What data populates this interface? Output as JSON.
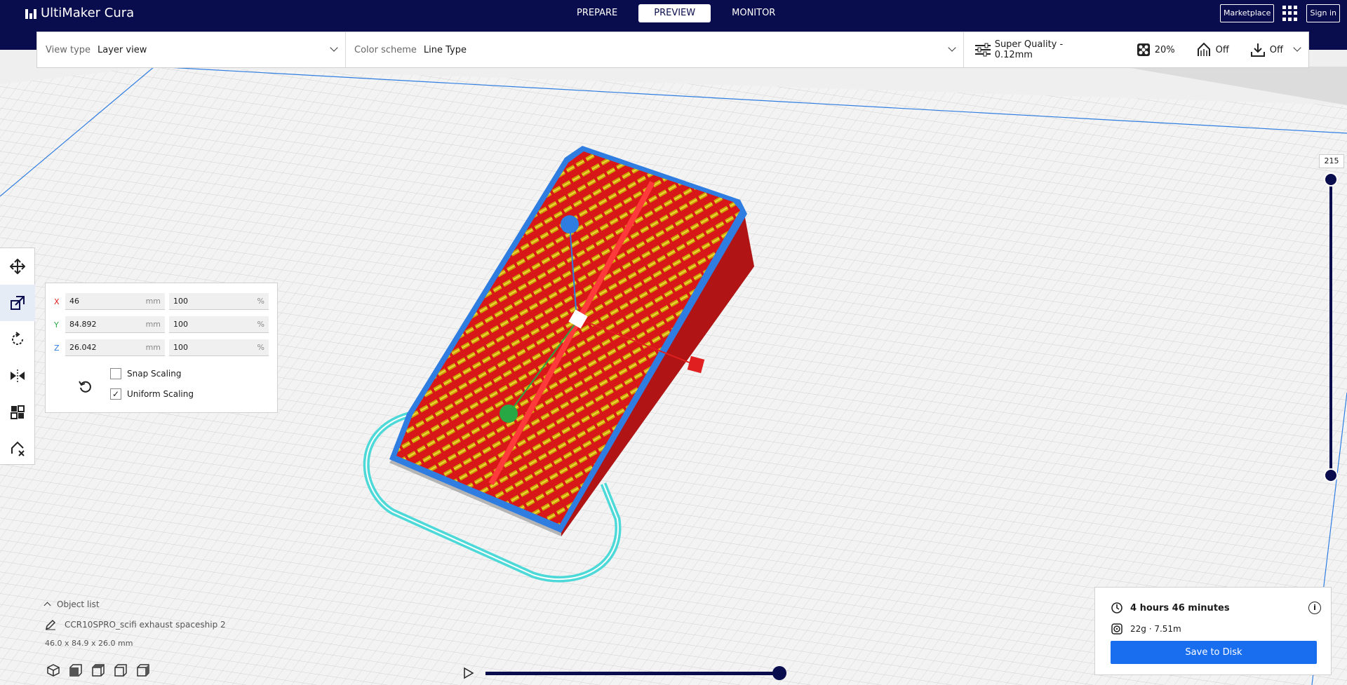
{
  "app": {
    "title": "UltiMaker Cura"
  },
  "nav": {
    "tabs": [
      "PREPARE",
      "PREVIEW",
      "MONITOR"
    ],
    "active": "PREVIEW"
  },
  "header_right": {
    "marketplace": "Marketplace",
    "signin": "Sign in"
  },
  "settings": {
    "view_type_label": "View type",
    "view_type_value": "Layer view",
    "color_scheme_label": "Color scheme",
    "color_scheme_value": "Line Type",
    "profile": "Super Quality - 0.12mm",
    "infill": "20%",
    "support": "Off",
    "adhesion": "Off"
  },
  "scale_tool": {
    "x": {
      "axis": "X",
      "mm": "46",
      "unit_mm": "mm",
      "pct": "100",
      "unit_pct": "%"
    },
    "y": {
      "axis": "Y",
      "mm": "84.892",
      "unit_mm": "mm",
      "pct": "100",
      "unit_pct": "%"
    },
    "z": {
      "axis": "Z",
      "mm": "26.042",
      "unit_mm": "mm",
      "pct": "100",
      "unit_pct": "%"
    },
    "snap_scaling": {
      "label": "Snap Scaling",
      "checked": false
    },
    "uniform_scaling": {
      "label": "Uniform Scaling",
      "checked": true
    }
  },
  "layer_slider": {
    "current_layer": "215"
  },
  "object_list": {
    "header": "Object list",
    "object_name": "CCR10SPRO_scifi exhaust spaceship 2",
    "dimensions": "46.0 x 84.9 x 26.0 mm"
  },
  "print_info": {
    "time": "4 hours 46 minutes",
    "material": "22g · 7.51m",
    "save_label": "Save to Disk"
  },
  "colors": {
    "header_bg": "#0a0d4d",
    "accent_blue": "#196ef0",
    "model_red": "#e02020",
    "skirt_cyan": "#3cd6d6"
  }
}
